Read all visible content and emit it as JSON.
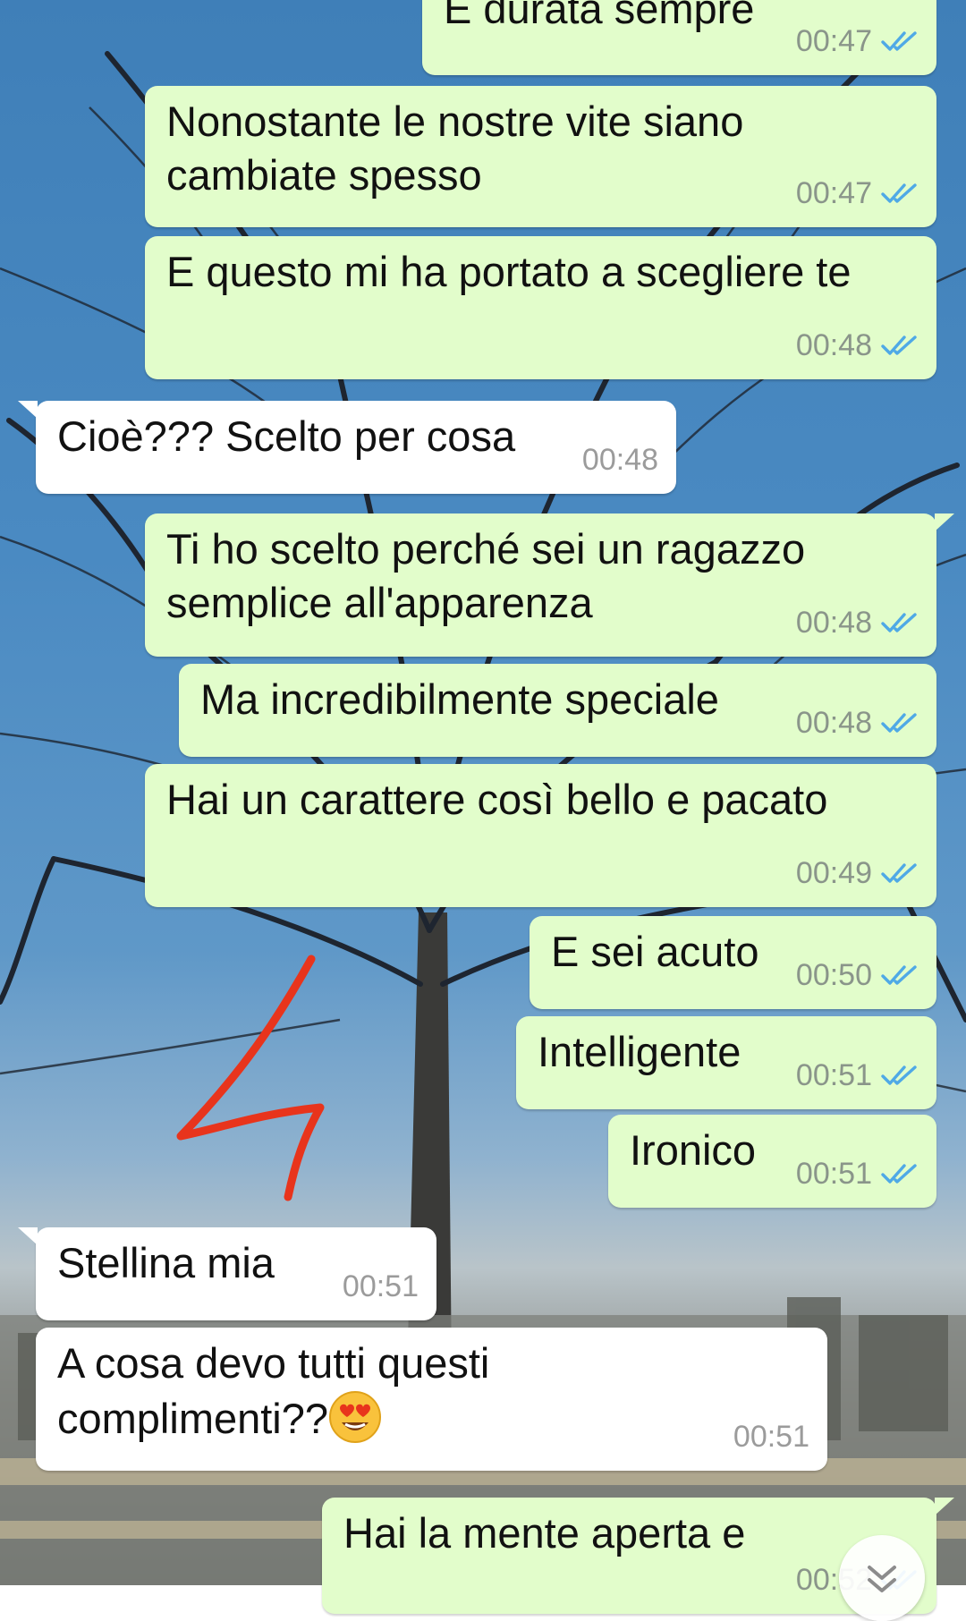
{
  "chat": {
    "messages": [
      {
        "id": "m1",
        "dir": "out",
        "text": "È durata sempre",
        "time": "00:47",
        "status": "read"
      },
      {
        "id": "m2",
        "dir": "out",
        "text": "Nonostante le nostre vite siano\ncambiate spesso",
        "time": "00:47",
        "status": "read"
      },
      {
        "id": "m3",
        "dir": "out",
        "text": "E questo mi ha portato a scegliere te",
        "time": "00:48",
        "status": "read"
      },
      {
        "id": "m4",
        "dir": "in",
        "text": "Cioè??? Scelto per cosa",
        "time": "00:48"
      },
      {
        "id": "m5",
        "dir": "out",
        "text": "Ti ho scelto perché sei un ragazzo\nsemplice all'apparenza",
        "time": "00:48",
        "status": "read"
      },
      {
        "id": "m6",
        "dir": "out",
        "text": "Ma incredibilmente speciale",
        "time": "00:48",
        "status": "read"
      },
      {
        "id": "m7",
        "dir": "out",
        "text": "Hai un carattere così bello e pacato",
        "time": "00:49",
        "status": "read"
      },
      {
        "id": "m8",
        "dir": "out",
        "text": "E sei acuto",
        "time": "00:50",
        "status": "read"
      },
      {
        "id": "m9",
        "dir": "out",
        "text": "Intelligente",
        "time": "00:51",
        "status": "read"
      },
      {
        "id": "m10",
        "dir": "out",
        "text": "Ironico",
        "time": "00:51",
        "status": "read"
      },
      {
        "id": "m11",
        "dir": "in",
        "text": "Stellina mia",
        "time": "00:51"
      },
      {
        "id": "m12",
        "dir": "in",
        "text": "A cosa devo tutti questi\ncomplimenti??",
        "emoji": "smiling-face-with-heart-eyes",
        "time": "00:51"
      },
      {
        "id": "m13",
        "dir": "out",
        "text": "Hai la mente aperta e",
        "time": "00:52",
        "status": "read"
      }
    ]
  },
  "colors": {
    "outgoing_bubble": "#e2fdcb",
    "incoming_bubble": "#ffffff",
    "read_tick": "#4fa9e6",
    "annotation_arrow": "#e8341c"
  },
  "icons": {
    "read_receipt": "double-check-icon",
    "scroll_down": "chevron-double-down-icon"
  }
}
